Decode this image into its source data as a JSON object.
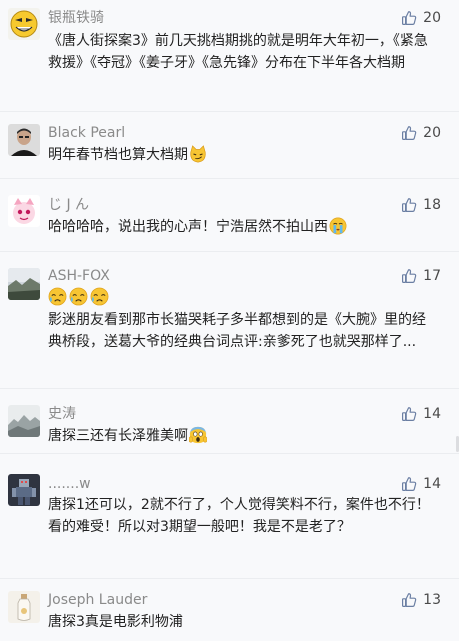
{
  "comments": [
    {
      "user": "银瓶铁骑",
      "likes": "20",
      "text": "《唐人街探案3》前几天挑档期挑的就是明年大年初一，《紧急救援》《夺冠》《姜子牙》《急先锋》分布在下半年各大档期",
      "avatar_icon": "gold-emoji-face-avatar"
    },
    {
      "user": "Black Pearl",
      "likes": "20",
      "text": "明年春节档也算大档期",
      "emoji": "smirk-cat-emoji",
      "avatar_icon": "man-portrait-avatar"
    },
    {
      "user": "じ J ん",
      "likes": "18",
      "text": "哈哈哈哈，说出我的心声！宁浩居然不拍山西",
      "emoji": "crying-face-emoji",
      "avatar_icon": "pink-cartoon-avatar"
    },
    {
      "user": "ASH-FOX",
      "likes": "17",
      "text": "影迷朋友看到那市长猫哭耗子多半都想到的是《大腕》里的经典桥段，送葛大爷的经典台词点评:亲爹死了也就哭那样了...",
      "emoji": "sobbing-face-emoji",
      "avatar_icon": "landscape-photo-avatar"
    },
    {
      "user": "史涛",
      "likes": "14",
      "text": "唐探三还有长泽雅美啊",
      "emoji": "scream-face-emoji",
      "avatar_icon": "misty-mountain-avatar"
    },
    {
      "user": ".......w",
      "likes": "14",
      "text": "唐探1还可以，2就不行了，个人觉得笑料不行，案件也不行！看的难受！所以对3期望一般吧！我是不是老了？",
      "avatar_icon": "robot-figure-avatar"
    },
    {
      "user": "Joseph Lauder",
      "likes": "13",
      "text": "唐探3真是电影利物浦",
      "avatar_icon": "glass-bottle-avatar"
    }
  ],
  "colors": {
    "background": "#f8f9fb",
    "username": "#8a8a8a",
    "text": "#222222",
    "divider": "#ebedf0",
    "like_icon": "#6b7fa3"
  }
}
